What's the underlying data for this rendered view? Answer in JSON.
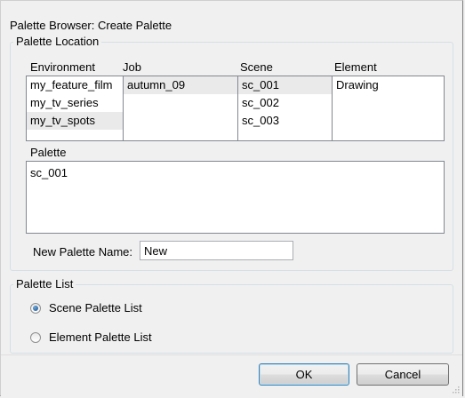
{
  "dialog": {
    "title": "Palette Browser:  Create Palette"
  },
  "palette_location": {
    "label": "Palette Location",
    "columns": {
      "environment": {
        "header": "Environment",
        "items": [
          "my_feature_film",
          "my_tv_series",
          "my_tv_spots"
        ],
        "selected_index": 2
      },
      "job": {
        "header": "Job",
        "items": [
          "autumn_09"
        ],
        "selected_index": 0
      },
      "scene": {
        "header": "Scene",
        "items": [
          "sc_001",
          "sc_002",
          "sc_003"
        ],
        "selected_index": 0
      },
      "element": {
        "header": "Element",
        "items": [
          "Drawing"
        ],
        "selected_index": -1
      }
    },
    "palette": {
      "label": "Palette",
      "items": [
        "sc_001"
      ]
    },
    "new_name": {
      "label": "New Palette Name:",
      "value": "New"
    }
  },
  "palette_list": {
    "label": "Palette List",
    "options": [
      {
        "label": "Scene Palette List",
        "checked": true
      },
      {
        "label": "Element Palette List",
        "checked": false
      }
    ]
  },
  "buttons": {
    "ok": "OK",
    "cancel": "Cancel"
  }
}
